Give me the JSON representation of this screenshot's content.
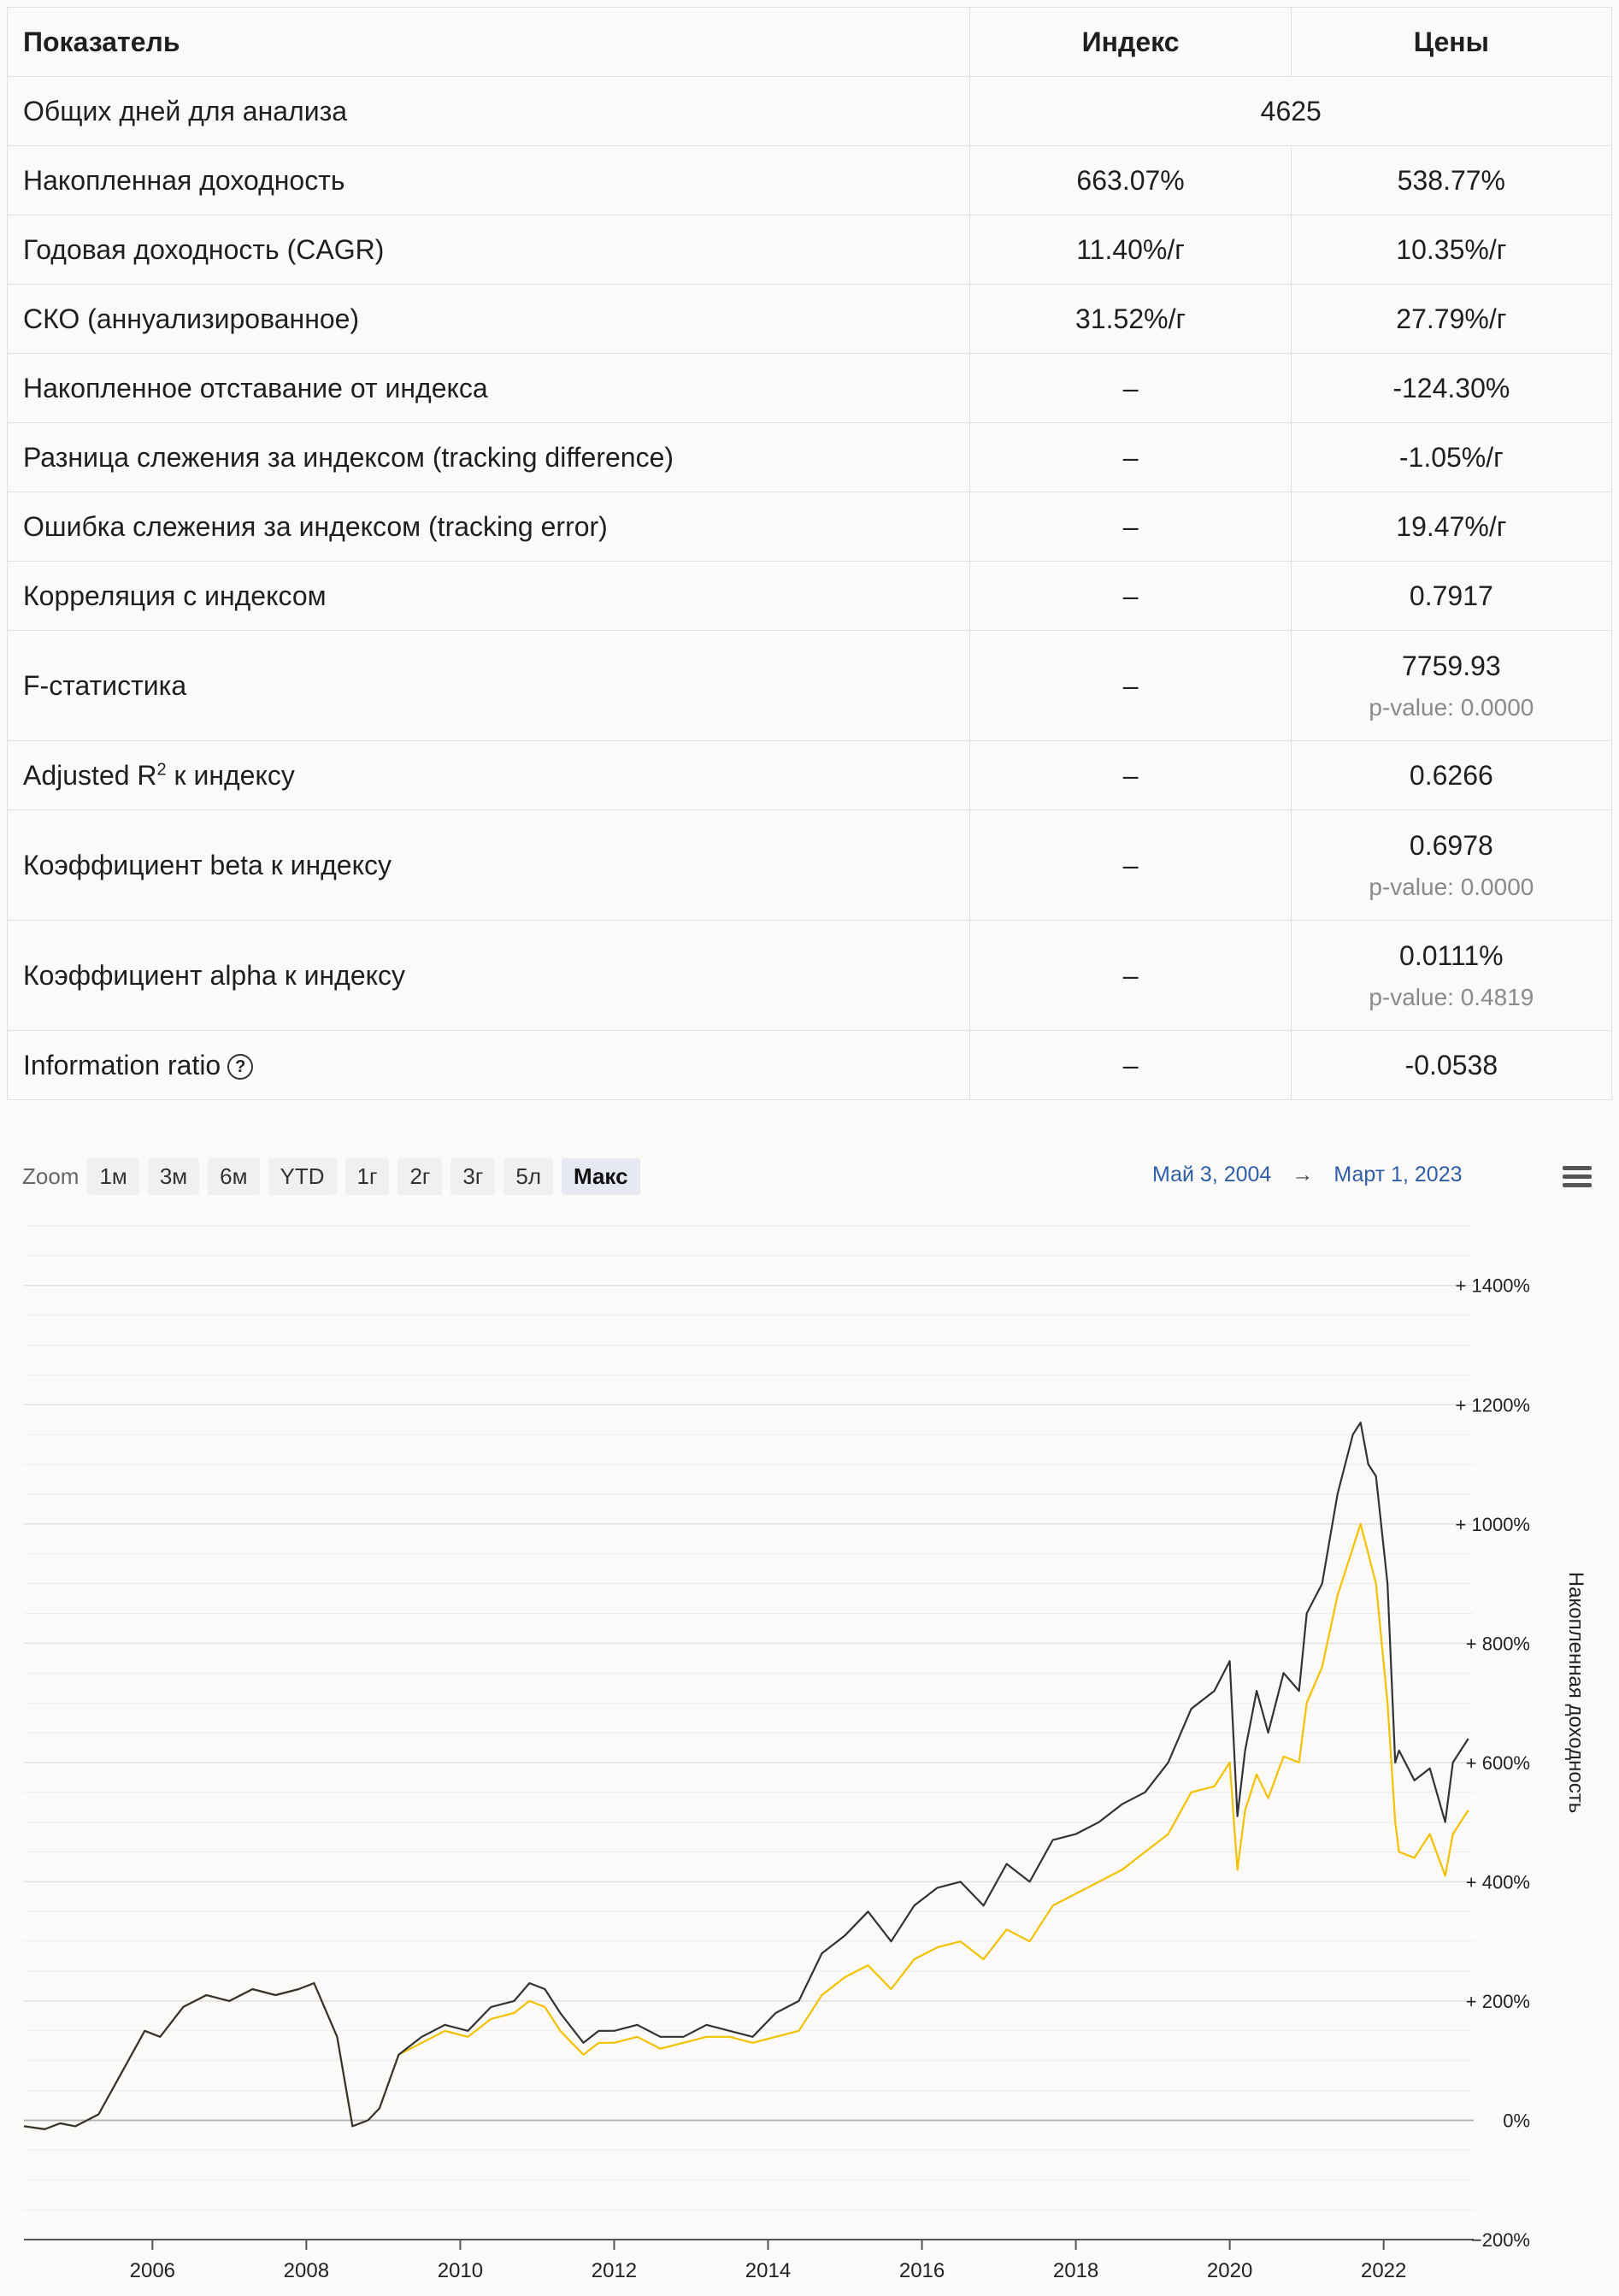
{
  "table": {
    "headers": [
      "Показатель",
      "Индекс",
      "Цены"
    ],
    "rows": [
      {
        "label": "Общих дней для анализа",
        "merged": "4625"
      },
      {
        "label": "Накопленная доходность",
        "index": "663.07%",
        "prices": "538.77%"
      },
      {
        "label": "Годовая доходность (CAGR)",
        "index": "11.40%/г",
        "prices": "10.35%/г"
      },
      {
        "label": "СКО (аннуализированное)",
        "index": "31.52%/г",
        "prices": "27.79%/г"
      },
      {
        "label": "Накопленное отставание от индекса",
        "index": "–",
        "prices": "-124.30%"
      },
      {
        "label": "Разница слежения за индексом (tracking difference)",
        "index": "–",
        "prices": "-1.05%/г"
      },
      {
        "label": "Ошибка слежения за индексом (tracking error)",
        "index": "–",
        "prices": "19.47%/г"
      },
      {
        "label": "Корреляция с индексом",
        "index": "–",
        "prices": "0.7917"
      },
      {
        "label": "F-статистика",
        "index": "–",
        "prices": "7759.93",
        "pvalue": "p-value: 0.0000"
      },
      {
        "label_a": "Adjusted R",
        "label_sup": "2",
        "label_b": " к индексу",
        "index": "–",
        "prices": "0.6266"
      },
      {
        "label": "Коэффициент beta к индексу",
        "index": "–",
        "prices": "0.6978",
        "pvalue": "p-value: 0.0000"
      },
      {
        "label": "Коэффициент alpha к индексу",
        "index": "–",
        "prices": "0.0111%",
        "pvalue": "p-value: 0.4819"
      },
      {
        "label": "Information ratio",
        "icon": "question-circle-icon",
        "icon_glyph": "?",
        "index": "–",
        "prices": "-0.0538"
      }
    ]
  },
  "toolbar": {
    "zoom_label": "Zoom",
    "buttons": [
      "1м",
      "3м",
      "6м",
      "YTD",
      "1г",
      "2г",
      "3г",
      "5л",
      "Макс"
    ],
    "active": "Макс",
    "range_from": "Май 3, 2004",
    "range_arrow": "→",
    "range_to": "Март 1, 2023",
    "menu_icon": "hamburger-menu-icon"
  },
  "chart_data": {
    "type": "line",
    "ylabel": "Накопленная доходность",
    "y_ticks": [
      "−200%",
      "0%",
      "+ 200%",
      "+ 400%",
      "+ 600%",
      "+ 800%",
      "+ 1000%",
      "+ 1200%",
      "+ 1400%"
    ],
    "x_ticks": [
      "2006",
      "2008",
      "2010",
      "2012",
      "2014",
      "2016",
      "2018",
      "2020",
      "2022"
    ],
    "ylim": [
      -200,
      1520
    ],
    "xlim": [
      2004.33,
      2023.17
    ],
    "grid": true,
    "series": [
      {
        "color": "#333333",
        "x": [
          2004.33,
          2004.6,
          2004.8,
          2005.0,
          2005.3,
          2005.6,
          2005.9,
          2006.1,
          2006.4,
          2006.7,
          2007.0,
          2007.3,
          2007.6,
          2007.9,
          2008.1,
          2008.4,
          2008.6,
          2008.8,
          2008.95,
          2009.2,
          2009.5,
          2009.8,
          2010.1,
          2010.4,
          2010.7,
          2010.9,
          2011.1,
          2011.3,
          2011.6,
          2011.8,
          2012.0,
          2012.3,
          2012.6,
          2012.9,
          2013.2,
          2013.5,
          2013.8,
          2014.1,
          2014.4,
          2014.7,
          2015.0,
          2015.3,
          2015.6,
          2015.9,
          2016.2,
          2016.5,
          2016.8,
          2017.1,
          2017.4,
          2017.7,
          2018.0,
          2018.3,
          2018.6,
          2018.9,
          2019.2,
          2019.5,
          2019.8,
          2020.0,
          2020.1,
          2020.2,
          2020.35,
          2020.5,
          2020.7,
          2020.9,
          2021.0,
          2021.2,
          2021.4,
          2021.6,
          2021.7,
          2021.8,
          2021.9,
          2022.05,
          2022.15,
          2022.2,
          2022.4,
          2022.6,
          2022.8,
          2022.9,
          2023.0,
          2023.1
        ],
        "values": [
          -10,
          -15,
          -5,
          -10,
          10,
          80,
          150,
          140,
          190,
          210,
          200,
          220,
          210,
          220,
          230,
          140,
          -10,
          0,
          20,
          110,
          140,
          160,
          150,
          190,
          200,
          230,
          220,
          180,
          130,
          150,
          150,
          160,
          140,
          140,
          160,
          150,
          140,
          180,
          200,
          280,
          310,
          350,
          300,
          360,
          390,
          400,
          360,
          430,
          400,
          470,
          480,
          500,
          530,
          550,
          600,
          690,
          720,
          770,
          510,
          620,
          720,
          650,
          750,
          720,
          850,
          900,
          1050,
          1150,
          1170,
          1100,
          1080,
          900,
          600,
          620,
          570,
          590,
          500,
          600,
          620,
          640
        ]
      },
      {
        "color": "#f2c100",
        "x": [
          2004.33,
          2004.6,
          2004.8,
          2005.0,
          2005.3,
          2005.6,
          2005.9,
          2006.1,
          2006.4,
          2006.7,
          2007.0,
          2007.3,
          2007.6,
          2007.9,
          2008.1,
          2008.4,
          2008.6,
          2008.8,
          2008.95,
          2009.2,
          2009.5,
          2009.8,
          2010.1,
          2010.4,
          2010.7,
          2010.9,
          2011.1,
          2011.3,
          2011.6,
          2011.8,
          2012.0,
          2012.3,
          2012.6,
          2012.9,
          2013.2,
          2013.5,
          2013.8,
          2014.1,
          2014.4,
          2014.7,
          2015.0,
          2015.3,
          2015.6,
          2015.9,
          2016.2,
          2016.5,
          2016.8,
          2017.1,
          2017.4,
          2017.7,
          2018.0,
          2018.3,
          2018.6,
          2018.9,
          2019.2,
          2019.5,
          2019.8,
          2020.0,
          2020.1,
          2020.2,
          2020.35,
          2020.5,
          2020.7,
          2020.9,
          2021.0,
          2021.2,
          2021.4,
          2021.6,
          2021.7,
          2021.8,
          2021.9,
          2022.05,
          2022.15,
          2022.2,
          2022.4,
          2022.6,
          2022.8,
          2022.9,
          2023.0,
          2023.1
        ],
        "values": [
          -10,
          -15,
          -5,
          -10,
          10,
          80,
          150,
          140,
          190,
          210,
          200,
          220,
          210,
          220,
          230,
          140,
          -10,
          0,
          20,
          110,
          130,
          150,
          140,
          170,
          180,
          200,
          190,
          150,
          110,
          130,
          130,
          140,
          120,
          130,
          140,
          140,
          130,
          140,
          150,
          210,
          240,
          260,
          220,
          270,
          290,
          300,
          270,
          320,
          300,
          360,
          380,
          400,
          420,
          450,
          480,
          550,
          560,
          600,
          420,
          520,
          580,
          540,
          610,
          600,
          700,
          760,
          880,
          960,
          1000,
          950,
          900,
          700,
          500,
          450,
          440,
          480,
          410,
          480,
          500,
          520
        ]
      }
    ]
  }
}
